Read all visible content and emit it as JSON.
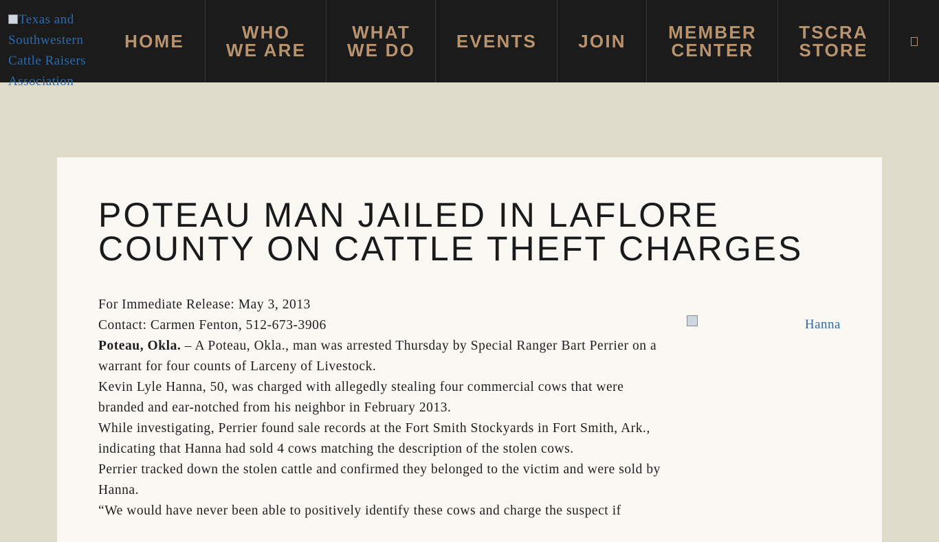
{
  "header": {
    "logo_alt": "Texas and Southwestern Cattle Raisers Association",
    "nav": {
      "home": "HOME",
      "who_1": "WHO",
      "who_2": "WE ARE",
      "what_1": "WHAT",
      "what_2": "WE DO",
      "events": "EVENTS",
      "join": "JOIN",
      "member_1": "MEMBER",
      "member_2": "CENTER",
      "store_1": "TSCRA",
      "store_2": "STORE"
    },
    "search_icon": "search-icon"
  },
  "article": {
    "title": "POTEAU MAN JAILED IN LAFLORE COUNTY ON CATTLE THEFT CHARGES",
    "release": "For Immediate Release: May 3, 2013",
    "contact": "Contact: Carmen Fenton, 512-673-3906",
    "dateline": "Poteau, Okla.",
    "lead": " – A Poteau, Okla., man was arrested Thursday by Special Ranger Bart Perrier on a warrant for four counts of Larceny of Livestock.",
    "p2": "Kevin Lyle Hanna, 50, was charged with allegedly stealing four commercial cows that were branded and ear-notched from his neighbor in February 2013.",
    "p3": "While investigating, Perrier found sale records at the Fort Smith Stockyards in Fort Smith, Ark., indicating that Hanna had sold 4 cows matching the description of the stolen cows.",
    "p4": "Perrier tracked down the stolen cattle and confirmed they belonged to the victim and were sold by Hanna.",
    "p5": "“We would have never been able to positively identify these cows and charge the suspect if",
    "photo_alt": "Hanna"
  },
  "colors": {
    "nav_bg": "#1b1b1b",
    "nav_text": "#b8936e",
    "page_bg": "#e0dccb",
    "card_bg": "#faf8f2",
    "link": "#2a6bb0"
  }
}
